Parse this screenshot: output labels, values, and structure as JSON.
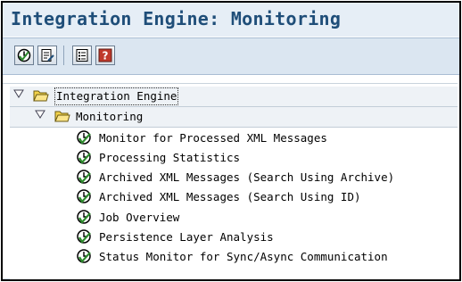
{
  "window": {
    "title": "Integration Engine: Monitoring"
  },
  "toolbar": {
    "buttons": [
      {
        "icon": "execute-clock-icon"
      },
      {
        "icon": "document-edit-icon"
      },
      {
        "icon": "list-detail-icon"
      },
      {
        "icon": "help-icon"
      }
    ]
  },
  "tree": {
    "root": {
      "label": "Integration Engine",
      "expanded": true
    },
    "folder": {
      "label": "Monitoring",
      "expanded": true
    },
    "items": [
      {
        "label": "Monitor for Processed XML Messages"
      },
      {
        "label": "Processing Statistics"
      },
      {
        "label": "Archived XML Messages (Search Using Archive)"
      },
      {
        "label": "Archived XML Messages (Search Using ID)"
      },
      {
        "label": "Job Overview"
      },
      {
        "label": "Persistence Layer Analysis"
      },
      {
        "label": "Status Monitor for Sync/Async Communication"
      }
    ]
  },
  "colors": {
    "title": "#1f4e79",
    "titlebar_bg": "#e6eef6",
    "toolbar_bg": "#dbe6f1",
    "icon_green": "#2e8b2e",
    "folder_yellow": "#f2d24b"
  }
}
